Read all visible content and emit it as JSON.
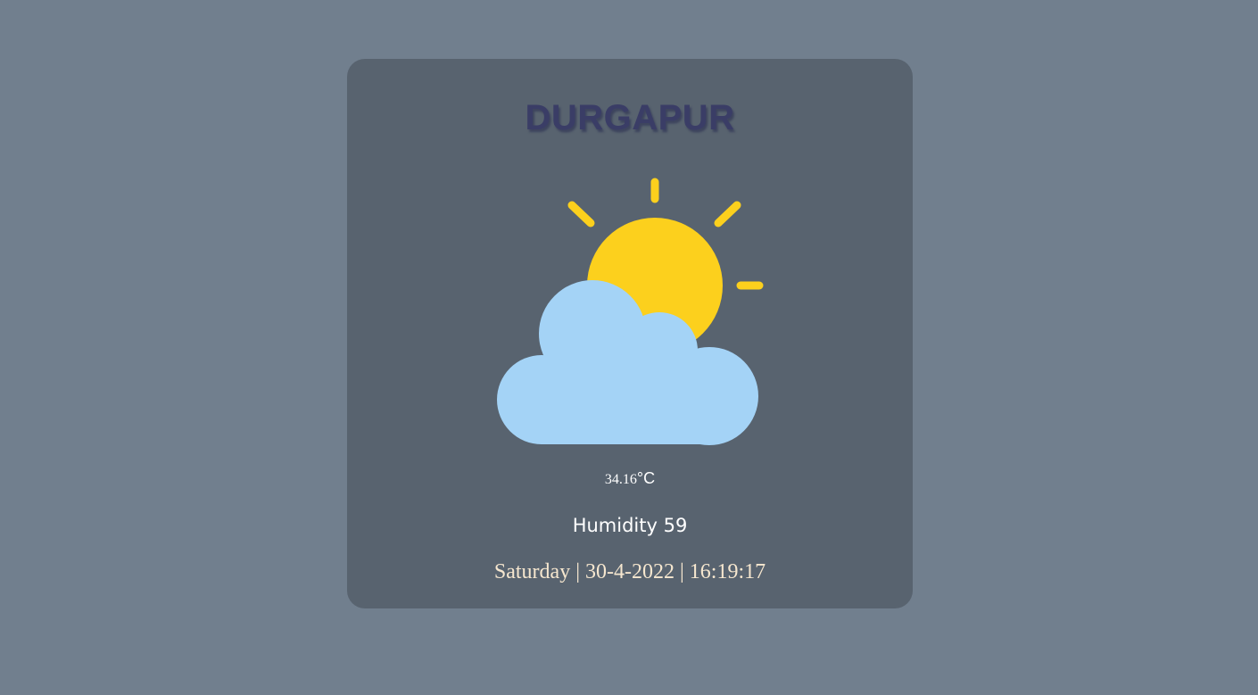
{
  "weather": {
    "city": "DURGAPUR",
    "icon": "partly-cloudy-sun-icon",
    "temperature": "34.16",
    "temperature_unit": "°C",
    "humidity": "Humidity 59",
    "datetime": "Saturday | 30-4-2022 | 16:19:17"
  },
  "colors": {
    "page_background": "#717f8e",
    "card_background": "#58636f",
    "city_text": "#3a3d66",
    "sun": "#fcd01d",
    "cloud": "#a4d3f6",
    "datetime_text": "#f6e7cf"
  }
}
